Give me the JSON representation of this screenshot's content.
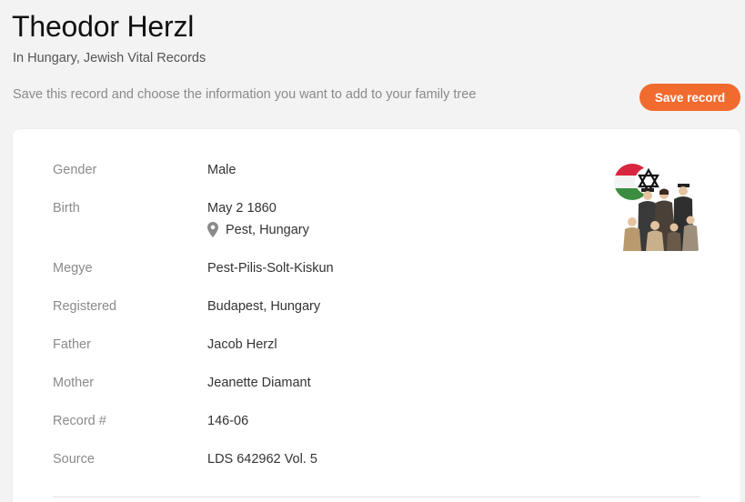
{
  "header": {
    "title": "Theodor Herzl",
    "subtitle": "In Hungary, Jewish Vital Records",
    "save_hint": "Save this record and choose the information you want to add to your family tree",
    "save_button": "Save record"
  },
  "record": {
    "gender": {
      "label": "Gender",
      "value": "Male"
    },
    "birth": {
      "label": "Birth",
      "date": "May 2 1860",
      "place": "Pest, Hungary"
    },
    "megye": {
      "label": "Megye",
      "value": "Pest-Pilis-Solt-Kiskun"
    },
    "registered": {
      "label": "Registered",
      "value": "Budapest, Hungary"
    },
    "father": {
      "label": "Father",
      "value": "Jacob Herzl"
    },
    "mother": {
      "label": "Mother",
      "value": "Jeanette Diamant"
    },
    "record_no": {
      "label": "Record #",
      "value": "146-06"
    },
    "source": {
      "label": "Source",
      "value": "LDS 642962 Vol. 5"
    }
  },
  "colors": {
    "accent": "#f26b2e",
    "background": "#f3f3f3",
    "card": "#ffffff",
    "label": "#8a8a8a",
    "value": "#333333"
  },
  "icons": {
    "place": "map-pin-icon",
    "collection": "hungary-jewish-records-collection-icon"
  }
}
